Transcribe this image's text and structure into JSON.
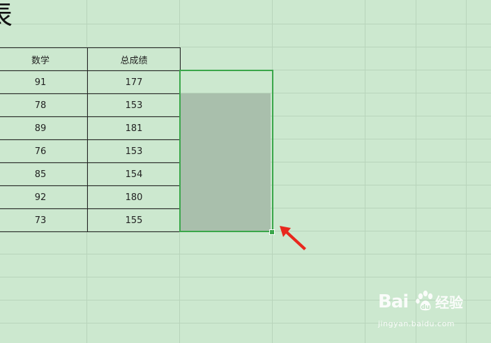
{
  "sheet": {
    "title_fragment": "表",
    "headers": [
      "数学",
      "总成绩"
    ],
    "rows": [
      [
        "91",
        "177"
      ],
      [
        "78",
        "153"
      ],
      [
        "89",
        "181"
      ],
      [
        "76",
        "153"
      ],
      [
        "85",
        "154"
      ],
      [
        "92",
        "180"
      ],
      [
        "73",
        "155"
      ]
    ]
  },
  "watermark": {
    "brand_a": "Bai",
    "brand_b": "du",
    "brand_c": "经验",
    "url": "jingyan.baidu.com"
  },
  "colors": {
    "sheet_background": "#cce8cf",
    "selection_border": "#3aa64a",
    "selection_fill": "#a9bfac",
    "arrow": "#e8281e"
  }
}
